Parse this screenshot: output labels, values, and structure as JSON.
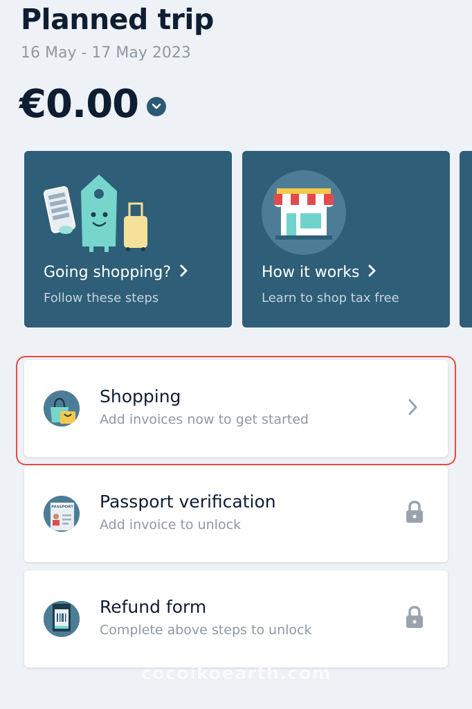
{
  "header": {
    "title": "Planned trip",
    "dates": "16 May - 17 May 2023",
    "amount": "€0.00",
    "amount_toggle_icon": "chevron-down-icon"
  },
  "promo_cards": [
    {
      "title": "Going shopping?",
      "subtitle": "Follow these steps",
      "icon": "shopping-tag-mascot-icon"
    },
    {
      "title": "How it works",
      "subtitle": "Learn to shop tax free",
      "icon": "store-icon"
    }
  ],
  "steps": [
    {
      "title": "Shopping",
      "subtitle": "Add invoices now to get started",
      "icon": "shopping-bag-icon",
      "action_icon": "chevron-right-icon"
    },
    {
      "title": "Passport verification",
      "subtitle": "Add invoice to unlock",
      "icon": "passport-icon",
      "action_icon": "lock-icon"
    },
    {
      "title": "Refund form",
      "subtitle": "Complete above steps to unlock",
      "icon": "barcode-form-icon",
      "action_icon": "lock-icon"
    }
  ],
  "watermark": "cocoikoearth.com",
  "colors": {
    "card_bg": "#2e5e78",
    "highlight": "#e8493c",
    "text_dark": "#0f1d33",
    "text_muted": "#8e98a3"
  }
}
